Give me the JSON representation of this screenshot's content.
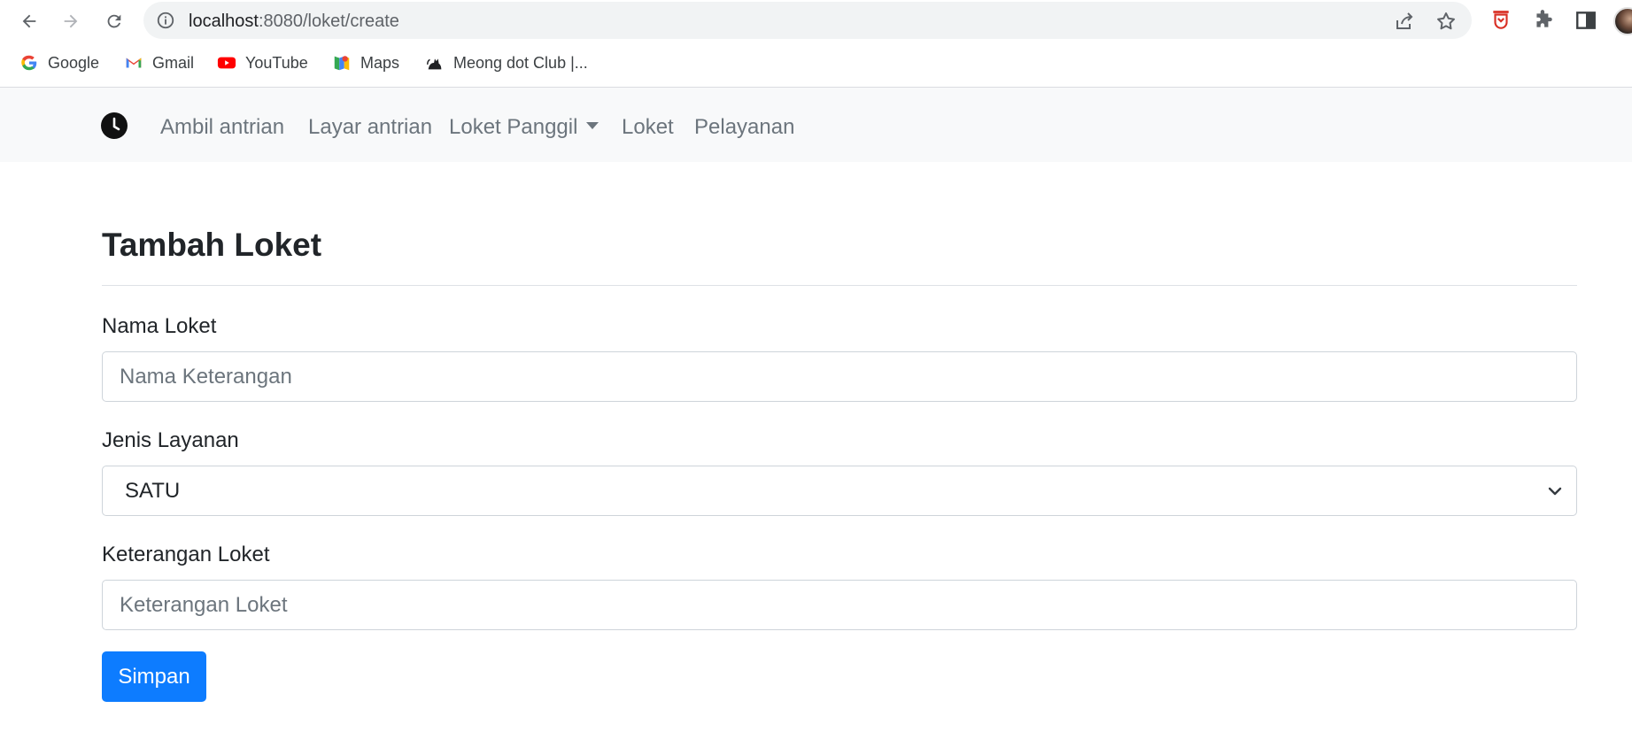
{
  "browser": {
    "url_host": "localhost",
    "url_path": ":8080/loket/create",
    "bookmarks": [
      {
        "label": "Google",
        "icon": "google-icon"
      },
      {
        "label": "Gmail",
        "icon": "gmail-icon"
      },
      {
        "label": "YouTube",
        "icon": "youtube-icon"
      },
      {
        "label": "Maps",
        "icon": "maps-icon"
      },
      {
        "label": "Meong dot Club |...",
        "icon": "cat-icon"
      }
    ]
  },
  "navbar": {
    "brand_icon": "clock-icon",
    "links": [
      {
        "label": "Ambil antrian"
      },
      {
        "label": "Layar antrian"
      },
      {
        "label": "Loket Panggil",
        "dropdown": true
      },
      {
        "label": "Loket"
      },
      {
        "label": "Pelayanan"
      }
    ]
  },
  "form": {
    "title": "Tambah Loket",
    "nama_label": "Nama Loket",
    "nama_placeholder": "Nama Keterangan",
    "nama_value": "",
    "jenis_label": "Jenis Layanan",
    "jenis_selected": "SATU",
    "keterangan_label": "Keterangan Loket",
    "keterangan_placeholder": "Keterangan Loket",
    "keterangan_value": "",
    "submit_label": "Simpan"
  },
  "colors": {
    "primary": "#0d7cff",
    "navbar_bg": "#f8f9fa",
    "nav_link": "#6c757d"
  }
}
